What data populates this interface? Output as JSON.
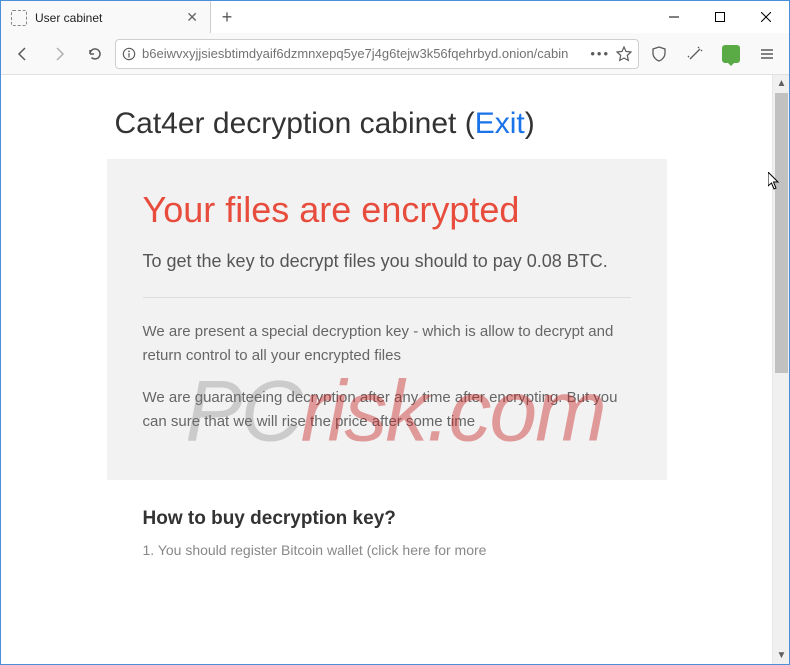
{
  "tab": {
    "title": "User cabinet"
  },
  "urlbar": {
    "url": "b6eiwvxyjjsiesbtimdyaif6dzmnxepq5ye7j4g6tejw3k56fqehrbyd.onion/cabin"
  },
  "page": {
    "title_prefix": "Cat4er decryption cabinet (",
    "exit_label": "Exit",
    "title_suffix": ")",
    "warning_heading": "Your files are encrypted",
    "lead": "To get the key to decrypt files you should to pay 0.08 BTC.",
    "para1": "We are present a special decryption key - which is allow to decrypt and return control to all your encrypted files",
    "para2": "We are guaranteeing decryption after any time after encrypting. But you can sure that we will rise the price after some time",
    "section2_title": "How to buy decryption key?",
    "cutoff_line": "1. You should register Bitcoin wallet (click here for more"
  },
  "watermark": {
    "prefix": "PC",
    "suffix": "risk.com"
  },
  "icons": {
    "back": "back-icon",
    "fwd": "forward-icon",
    "reload": "reload-icon",
    "lock": "lock-icon",
    "dots": "dots-icon",
    "star": "star-icon",
    "shield": "shield-icon",
    "wand": "wand-icon",
    "menu": "menu-icon",
    "ublock": "ublock-icon"
  }
}
